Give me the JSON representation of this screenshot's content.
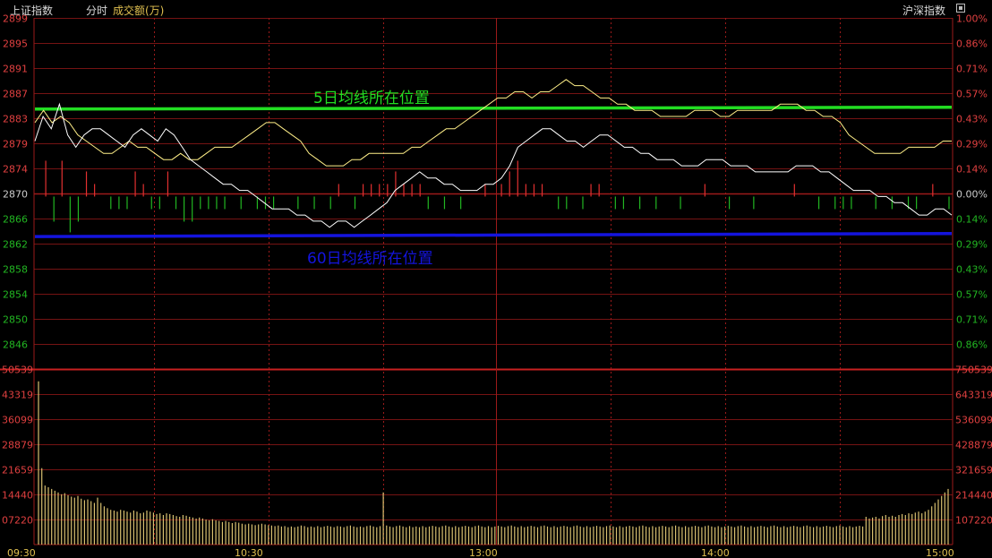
{
  "header": {
    "index_name": "上证指数",
    "mode": "分时",
    "indicator": "成交额(万)",
    "right_label": "沪深指数"
  },
  "colors": {
    "grid": "#9c1a1a",
    "price_axis": "#e04040",
    "price_line": "#ffffff",
    "avg_line": "#ffef88",
    "ma5": "#22dd22",
    "ma60": "#1414dd",
    "up_bar": "#e23030",
    "down_bar": "#22b622",
    "volume_bar": "#d8c070"
  },
  "annotations": {
    "ma5_label": "5日均线所在位置",
    "ma60_label": "60日均线所在位置"
  },
  "chart_data": [
    {
      "type": "line",
      "name": "price-panel",
      "x_axis_labels": [
        "09:30",
        "10:30",
        "13:00",
        "14:00",
        "15:00"
      ],
      "y_ticks_left": [
        "2899",
        "2895",
        "2891",
        "2887",
        "2883",
        "2879",
        "2874",
        "2870",
        "2866",
        "2862",
        "2858",
        "2854",
        "2850",
        "2846"
      ],
      "y_ticks_right": [
        "1.00%",
        "0.86%",
        "0.71%",
        "0.57%",
        "0.43%",
        "0.29%",
        "0.14%",
        "0.00%",
        "0.14%",
        "0.29%",
        "0.43%",
        "0.57%",
        "0.71%",
        "0.86%"
      ],
      "ylim": [
        2842,
        2899
      ],
      "base_value": 2870,
      "price": [
        2879,
        2883,
        2881,
        2885,
        2880,
        2878,
        2880,
        2881,
        2881,
        2880,
        2879,
        2878,
        2880,
        2881,
        2880,
        2879,
        2881,
        2880,
        2878,
        2876,
        2875,
        2874,
        2873,
        2872,
        2872,
        2871,
        2871,
        2870,
        2869,
        2868,
        2868,
        2868,
        2867,
        2867,
        2866,
        2866,
        2865,
        2866,
        2866,
        2865,
        2866,
        2867,
        2868,
        2869,
        2871,
        2872,
        2873,
        2874,
        2873,
        2873,
        2872,
        2872,
        2871,
        2871,
        2871,
        2872,
        2872,
        2873,
        2875,
        2878,
        2879,
        2880,
        2881,
        2881,
        2880,
        2879,
        2879,
        2878,
        2879,
        2880,
        2880,
        2879,
        2878,
        2878,
        2877,
        2877,
        2876,
        2876,
        2876,
        2875,
        2875,
        2875,
        2876,
        2876,
        2876,
        2875,
        2875,
        2875,
        2874,
        2874,
        2874,
        2874,
        2874,
        2875,
        2875,
        2875,
        2874,
        2874,
        2873,
        2872,
        2871,
        2871,
        2871,
        2870,
        2870,
        2869,
        2869,
        2868,
        2867,
        2867,
        2868,
        2868,
        2867
      ],
      "average": [
        2882,
        2884,
        2882,
        2883,
        2882,
        2880,
        2879,
        2878,
        2877,
        2877,
        2878,
        2879,
        2878,
        2878,
        2877,
        2876,
        2876,
        2877,
        2876,
        2876,
        2877,
        2878,
        2878,
        2878,
        2879,
        2880,
        2881,
        2882,
        2882,
        2881,
        2880,
        2879,
        2877,
        2876,
        2875,
        2875,
        2875,
        2876,
        2876,
        2877,
        2877,
        2877,
        2877,
        2877,
        2878,
        2878,
        2879,
        2880,
        2881,
        2881,
        2882,
        2883,
        2884,
        2885,
        2886,
        2886,
        2887,
        2887,
        2886,
        2887,
        2887,
        2888,
        2889,
        2888,
        2888,
        2887,
        2886,
        2886,
        2885,
        2885,
        2884,
        2884,
        2884,
        2883,
        2883,
        2883,
        2883,
        2884,
        2884,
        2884,
        2883,
        2883,
        2884,
        2884,
        2884,
        2884,
        2884,
        2885,
        2885,
        2885,
        2884,
        2884,
        2883,
        2883,
        2882,
        2880,
        2879,
        2878,
        2877,
        2877,
        2877,
        2877,
        2878,
        2878,
        2878,
        2878,
        2879,
        2879
      ],
      "ma5": [
        2884.2,
        2884.5
      ],
      "ma60": [
        2863.5,
        2864.0
      ]
    },
    {
      "type": "bar",
      "name": "volume-panel",
      "y_ticks_left": [
        "50539",
        "43319",
        "36099",
        "28879",
        "21659",
        "14440",
        "07220"
      ],
      "y_ticks_right": [
        "750539",
        "643319",
        "536099",
        "428879",
        "321659",
        "214440",
        "107220"
      ],
      "ylim": [
        0,
        50539
      ],
      "values": [
        47000,
        22000,
        17000,
        16500,
        16000,
        15500,
        15000,
        14500,
        14800,
        14200,
        13800,
        13500,
        14000,
        13200,
        12800,
        13000,
        12500,
        12000,
        13500,
        12000,
        11000,
        10500,
        10000,
        9800,
        9500,
        10000,
        9800,
        9500,
        9200,
        9800,
        9500,
        9000,
        9200,
        9800,
        9500,
        9200,
        8800,
        9000,
        8500,
        9000,
        8800,
        8500,
        8200,
        8000,
        8500,
        8300,
        8000,
        7800,
        7500,
        7800,
        7500,
        7200,
        7000,
        7300,
        7000,
        6800,
        6500,
        6800,
        6500,
        6200,
        6500,
        6300,
        6000,
        5800,
        6000,
        5800,
        5600,
        5800,
        6000,
        5800,
        5600,
        5500,
        5300,
        5500,
        5200,
        5300,
        5000,
        5200,
        5000,
        5200,
        5500,
        5300,
        5000,
        5200,
        5000,
        5300,
        5000,
        5200,
        5400,
        5200,
        5000,
        5300,
        5200,
        5000,
        5300,
        5500,
        5200,
        5000,
        5200,
        5000,
        5300,
        5500,
        5200,
        5000,
        5300,
        15000,
        5500,
        5200,
        5000,
        5300,
        5500,
        5200,
        5000,
        5300,
        5000,
        5200,
        5000,
        5300,
        5000,
        5200,
        5400,
        5200,
        5000,
        5300,
        5500,
        5200,
        5000,
        5300,
        5000,
        5200,
        5400,
        5200,
        5000,
        5300,
        5500,
        5200,
        5000,
        5300,
        5000,
        5200,
        5400,
        5200,
        5000,
        5300,
        5500,
        5200,
        5000,
        5300,
        5000,
        5200,
        5400,
        5200,
        5000,
        5300,
        5500,
        5200,
        5000,
        5300,
        5000,
        5200,
        5400,
        5200,
        5000,
        5300,
        5500,
        5200,
        5000,
        5300,
        5000,
        5200,
        5400,
        5200,
        5000,
        5300,
        5500,
        5200,
        5000,
        5300,
        5000,
        5200,
        5400,
        5200,
        5000,
        5300,
        5500,
        5200,
        5000,
        5300,
        5000,
        5200,
        5400,
        5200,
        5000,
        5300,
        5500,
        5200,
        5000,
        5300,
        5000,
        5200,
        5400,
        5200,
        5000,
        5300,
        5500,
        5200,
        5000,
        5300,
        5000,
        5200,
        5400,
        5200,
        5000,
        5300,
        5500,
        5200,
        5000,
        5300,
        5000,
        5200,
        5400,
        5200,
        5000,
        5300,
        5500,
        5200,
        5000,
        5300,
        5000,
        5200,
        5400,
        5200,
        5000,
        5300,
        5500,
        5200,
        5000,
        5300,
        5000,
        5200,
        5400,
        5200,
        5000,
        5300,
        5500,
        5200,
        5000,
        5300,
        5000,
        5200,
        5400,
        5200,
        8000,
        7500,
        7800,
        8000,
        7500,
        8200,
        8500,
        8000,
        8300,
        8000,
        8500,
        8800,
        8500,
        9000,
        8800,
        9200,
        9500,
        9000,
        9500,
        10000,
        11000,
        12000,
        13000,
        14000,
        15000,
        16000
      ]
    }
  ]
}
